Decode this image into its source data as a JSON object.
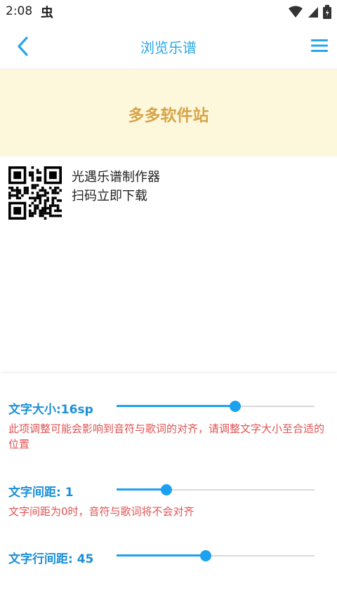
{
  "status_bar": {
    "time": "2:08",
    "notification_glyph": "虫",
    "icons": [
      "wifi-icon",
      "signal-icon",
      "battery-icon"
    ]
  },
  "header": {
    "title": "浏览乐谱",
    "back_icon": "chevron-left-icon",
    "menu_icon": "hamburger-menu-icon",
    "accent_color": "#29a6e6"
  },
  "banner": {
    "text": "多多软件站",
    "background": "#fdf8dc",
    "text_color": "#d6a54b"
  },
  "promo": {
    "line1": "光遇乐谱制作器",
    "line2": "扫码立即下载"
  },
  "settings": {
    "font_size": {
      "label": "文字大小:16sp",
      "note": "此项调整可能会影响到音符与歌词的对齐，请调整文字大小至合适的位置",
      "slider_fraction": 0.6
    },
    "letter_spacing": {
      "label": "文字间距: 1",
      "note": "文字间距为0时，音符与歌词将不会对齐",
      "slider_fraction": 0.25
    },
    "line_spacing": {
      "label": "文字行间距: 45",
      "slider_fraction": 0.45
    }
  }
}
